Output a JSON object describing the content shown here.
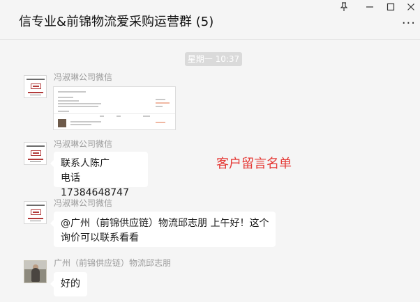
{
  "window": {
    "title": "信专业&前锦物流爱采购运营群 (5)",
    "more_glyph": "...",
    "controls": [
      "pin-icon",
      "minimize-icon",
      "maximize-icon",
      "close-icon"
    ]
  },
  "chat": {
    "timestamp": "星期一 10:37",
    "annotation": "客户留言名单",
    "messages": [
      {
        "sender": "冯淑琳公司微信",
        "type": "image"
      },
      {
        "sender": "冯淑琳公司微信",
        "type": "text",
        "lines": [
          "联系人陈广",
          "电话17384648747"
        ]
      },
      {
        "sender": "冯淑琳公司微信",
        "type": "text",
        "lines": [
          "@广州（前锦供应链）物流邱志朋 上午好！这个",
          "询价可以联系看看"
        ]
      },
      {
        "sender": "广州（前锦供应链）物流邱志朋",
        "type": "text",
        "lines": [
          "好的"
        ]
      }
    ]
  },
  "colors": {
    "background": "#f5f5f5",
    "bubble": "#ffffff",
    "annotation": "#e53935",
    "timestamp_pill": "#dadada"
  }
}
